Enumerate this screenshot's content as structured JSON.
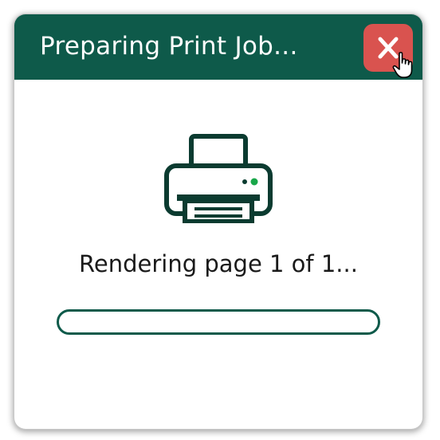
{
  "dialog": {
    "title": "Preparing Print Job...",
    "status": "Rendering page 1 of 1...",
    "progress_percent": 0
  },
  "icons": {
    "close": "close-icon",
    "printer": "printer-icon",
    "cursor": "hand-pointer-icon"
  },
  "colors": {
    "titlebar": "#0e5a4a",
    "close_button": "#d9534f",
    "indicator_light": "#19a74a"
  }
}
